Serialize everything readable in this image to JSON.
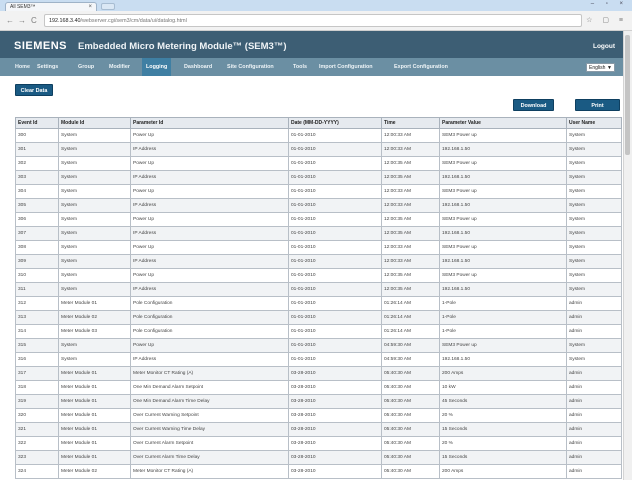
{
  "browser": {
    "tab_title": "All SEM3™",
    "tab_close": "×",
    "window_controls": "– ▫ ×",
    "back": "←",
    "forward": "→",
    "reload": "C",
    "url_host": "192.168.3.40",
    "url_path": "/webserver.cgi/sem3/cm/data/ui/datalog.html",
    "toolbar_icons": "☆ ▢ ≡"
  },
  "header": {
    "brand": "SIEMENS",
    "title": "Embedded Micro Metering Module™ (SEM3™)",
    "logout": "Logout"
  },
  "menu": {
    "items": [
      "Home",
      "Settings",
      "Group",
      "Modifier",
      "Logging",
      "Dashboard",
      "Site Configuration",
      "Tools",
      "Import Configuration",
      "Export Configuration"
    ],
    "active_index": 4,
    "language": "English"
  },
  "actions": {
    "clear_data": "Clear Data",
    "download": "Download",
    "print": "Print"
  },
  "table": {
    "columns": [
      "Event Id",
      "Module Id",
      "Parameter Id",
      "Date (MM-DD-YYYY)",
      "Time",
      "Parameter Value",
      "User Name"
    ],
    "rows": [
      [
        "300",
        "System",
        "Power Up",
        "01-01-2010",
        "12:00:33 AM",
        "SEM3 Power up",
        "System"
      ],
      [
        "301",
        "System",
        "IP Address",
        "01-01-2010",
        "12:00:33 AM",
        "192.168.1.50",
        "System"
      ],
      [
        "302",
        "System",
        "Power Up",
        "01-01-2010",
        "12:00:35 AM",
        "SEM3 Power up",
        "System"
      ],
      [
        "303",
        "System",
        "IP Address",
        "01-01-2010",
        "12:00:35 AM",
        "192.168.1.50",
        "System"
      ],
      [
        "304",
        "System",
        "Power Up",
        "01-01-2010",
        "12:00:33 AM",
        "SEM3 Power up",
        "System"
      ],
      [
        "305",
        "System",
        "IP Address",
        "01-01-2010",
        "12:00:33 AM",
        "192.168.1.50",
        "System"
      ],
      [
        "306",
        "System",
        "Power Up",
        "01-01-2010",
        "12:00:35 AM",
        "SEM3 Power up",
        "System"
      ],
      [
        "307",
        "System",
        "IP Address",
        "01-01-2010",
        "12:00:35 AM",
        "192.168.1.50",
        "System"
      ],
      [
        "308",
        "System",
        "Power Up",
        "01-01-2010",
        "12:00:33 AM",
        "SEM3 Power up",
        "System"
      ],
      [
        "309",
        "System",
        "IP Address",
        "01-01-2010",
        "12:00:33 AM",
        "192.168.1.50",
        "System"
      ],
      [
        "310",
        "System",
        "Power Up",
        "01-01-2010",
        "12:00:35 AM",
        "SEM3 Power up",
        "System"
      ],
      [
        "311",
        "System",
        "IP Address",
        "01-01-2010",
        "12:00:35 AM",
        "192.168.1.50",
        "System"
      ],
      [
        "312",
        "Meter Module 01",
        "Pole Configuration",
        "01-01-2010",
        "01:26:14 AM",
        "1-Pole",
        "admin"
      ],
      [
        "313",
        "Meter Module 02",
        "Pole Configuration",
        "01-01-2010",
        "01:26:14 AM",
        "1-Pole",
        "admin"
      ],
      [
        "314",
        "Meter Module 03",
        "Pole Configuration",
        "01-01-2010",
        "01:26:14 AM",
        "1-Pole",
        "admin"
      ],
      [
        "315",
        "System",
        "Power Up",
        "01-01-2010",
        "04:59:30 AM",
        "SEM3 Power up",
        "System"
      ],
      [
        "316",
        "System",
        "IP Address",
        "01-01-2010",
        "04:59:30 AM",
        "192.168.1.50",
        "System"
      ],
      [
        "317",
        "Meter Module 01",
        "Meter Monitor CT Rating (A)",
        "03-28-2010",
        "05:40:30 AM",
        "200 Amps",
        "admin"
      ],
      [
        "318",
        "Meter Module 01",
        "One Min Demand Alarm Setpoint",
        "03-28-2010",
        "05:40:30 AM",
        "10 kW",
        "admin"
      ],
      [
        "319",
        "Meter Module 01",
        "One Min Demand Alarm Time Delay",
        "03-28-2010",
        "05:40:30 AM",
        "45 Seconds",
        "admin"
      ],
      [
        "320",
        "Meter Module 01",
        "Over Current Warning Setpoint",
        "03-28-2010",
        "05:40:30 AM",
        "20 %",
        "admin"
      ],
      [
        "321",
        "Meter Module 01",
        "Over Current Warning Time Delay",
        "03-28-2010",
        "05:40:30 AM",
        "15 Seconds",
        "admin"
      ],
      [
        "322",
        "Meter Module 01",
        "Over Current Alarm Setpoint",
        "03-28-2010",
        "05:40:30 AM",
        "20 %",
        "admin"
      ],
      [
        "323",
        "Meter Module 01",
        "Over Current Alarm Time Delay",
        "03-28-2010",
        "05:40:30 AM",
        "15 Seconds",
        "admin"
      ],
      [
        "324",
        "Meter Module 02",
        "Meter Monitor CT Rating (A)",
        "03-28-2010",
        "05:40:30 AM",
        "200 Amps",
        "admin"
      ]
    ]
  }
}
